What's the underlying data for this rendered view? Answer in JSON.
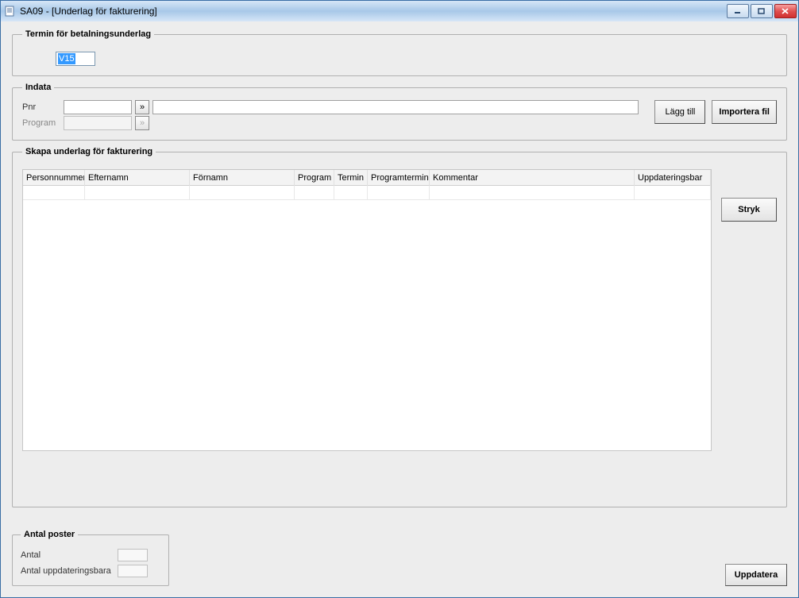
{
  "window": {
    "title": "SA09 - [Underlag för fakturering]"
  },
  "group_termin": {
    "legend": "Termin för betalningsunderlag",
    "value": "V15"
  },
  "group_indata": {
    "legend": "Indata",
    "pnr_label": "Pnr",
    "pnr_value": "",
    "pnr_lookup_glyph": "»",
    "program_label": "Program",
    "program_value": "",
    "program_lookup_glyph": "»",
    "long_value": "",
    "btn_add": "Lägg till",
    "btn_import": "Importera fil"
  },
  "group_skapa": {
    "legend": "Skapa underlag för fakturering",
    "columns": {
      "personnummer": "Personnummer",
      "efternamn": "Efternamn",
      "fornamn": "Förnamn",
      "program": "Program",
      "termin": "Termin",
      "programtermin": "Programtermin",
      "kommentar": "Kommentar",
      "uppdateringsbar": "Uppdateringsbar"
    },
    "btn_stryk": "Stryk"
  },
  "group_antal": {
    "legend": "Antal poster",
    "antal_label": "Antal",
    "antal_value": "",
    "antal_upp_label": "Antal uppdateringsbara",
    "antal_upp_value": ""
  },
  "btn_uppdatera": "Uppdatera"
}
